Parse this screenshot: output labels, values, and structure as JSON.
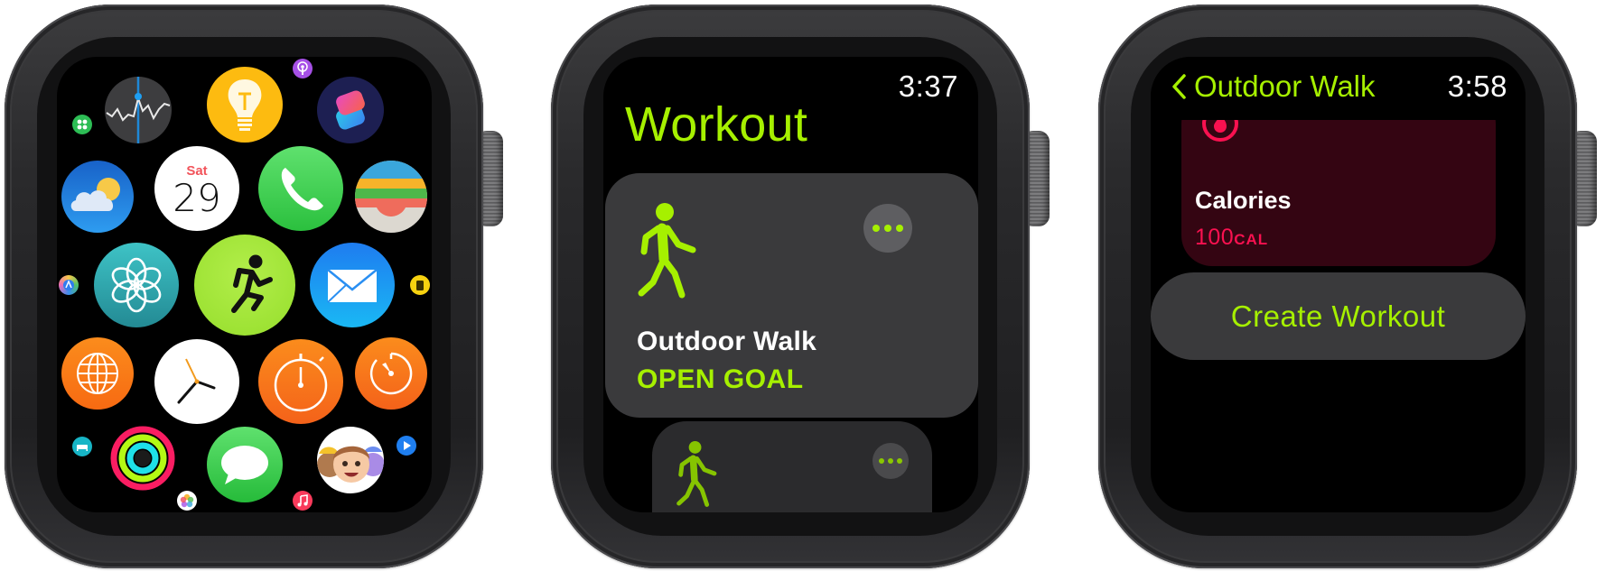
{
  "watches": [
    {
      "screen": "app-grid",
      "apps": [
        {
          "name": "Stocks",
          "icon": "stocks-icon"
        },
        {
          "name": "Tips",
          "icon": "lightbulb-icon"
        },
        {
          "name": "Podcasts",
          "icon": "podcasts-icon"
        },
        {
          "name": "Shortcuts",
          "icon": "shortcuts-icon"
        },
        {
          "name": "App Store",
          "icon": "app-grid-icon"
        },
        {
          "name": "Weather",
          "icon": "weather-icon"
        },
        {
          "name": "Calendar",
          "icon": "calendar-icon",
          "day": "Sat",
          "date": "29"
        },
        {
          "name": "Phone",
          "icon": "phone-icon"
        },
        {
          "name": "Wallet",
          "icon": "wallet-icon"
        },
        {
          "name": "Maps",
          "icon": "maps-icon"
        },
        {
          "name": "Breathe",
          "icon": "breathe-icon"
        },
        {
          "name": "Workout",
          "icon": "running-figure-icon"
        },
        {
          "name": "Mail",
          "icon": "mail-icon"
        },
        {
          "name": "Walkie-Talkie",
          "icon": "walkie-talkie-icon"
        },
        {
          "name": "World Clock",
          "icon": "globe-icon"
        },
        {
          "name": "Clock",
          "icon": "clock-icon"
        },
        {
          "name": "Stopwatch",
          "icon": "stopwatch-icon"
        },
        {
          "name": "Timer",
          "icon": "timer-icon"
        },
        {
          "name": "Sleep",
          "icon": "bed-icon"
        },
        {
          "name": "Activity",
          "icon": "activity-rings-icon"
        },
        {
          "name": "Messages",
          "icon": "messages-icon"
        },
        {
          "name": "Memoji",
          "icon": "memoji-icon"
        },
        {
          "name": "Now Playing",
          "icon": "play-icon"
        },
        {
          "name": "Photos",
          "icon": "photos-icon"
        },
        {
          "name": "Music",
          "icon": "music-note-icon"
        }
      ]
    },
    {
      "screen": "workout-list",
      "time": "3:37",
      "title": "Workout",
      "cards": [
        {
          "activity": "Outdoor Walk",
          "goal": "OPEN GOAL",
          "icon": "walking-figure-icon",
          "more": "more-options-icon"
        },
        {
          "activity": "",
          "goal": "",
          "icon": "walking-figure-icon",
          "more": "more-options-icon"
        }
      ]
    },
    {
      "screen": "workout-detail",
      "time": "3:58",
      "back_label": "Outdoor Walk",
      "goal_card": {
        "label": "Calories",
        "value": "100",
        "unit": "CAL",
        "icon": "flame-icon"
      },
      "create_button": "Create Workout"
    }
  ],
  "colors": {
    "accent_green": "#a6f000",
    "move_pink": "#fa1150",
    "card_gray": "#3a3a3c",
    "calorie_card": "#340512"
  }
}
